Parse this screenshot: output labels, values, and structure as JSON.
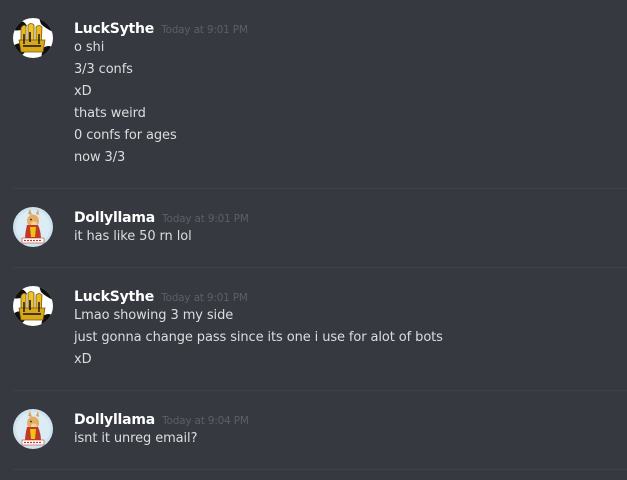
{
  "colors": {
    "background": "#36393f",
    "username": "#ffffff",
    "timestamp": "#5c5f64",
    "message_text": "#dcddde",
    "divider": "#3f4247"
  },
  "messages": [
    {
      "author": "LuckSythe",
      "avatar_icon": "yellow-black-pattern-avatar-icon",
      "timestamp": "Today at 9:01 PM",
      "lines": [
        "o shi",
        "3/3 confs",
        "xD",
        "thats weird",
        "0 confs for ages",
        "now 3/3"
      ]
    },
    {
      "author": "Dollyllama",
      "avatar_icon": "llama-portrait-avatar-icon",
      "timestamp": "Today at 9:01 PM",
      "lines": [
        "it has like 50 rn lol"
      ]
    },
    {
      "author": "LuckSythe",
      "avatar_icon": "yellow-black-pattern-avatar-icon",
      "timestamp": "Today at 9:01 PM",
      "lines": [
        "Lmao showing 3 my side",
        "just gonna change pass since its one i use for alot of bots",
        "xD"
      ]
    },
    {
      "author": "Dollyllama",
      "avatar_icon": "llama-portrait-avatar-icon",
      "timestamp": "Today at 9:04 PM",
      "lines": [
        "isnt it unreg email?"
      ]
    }
  ]
}
